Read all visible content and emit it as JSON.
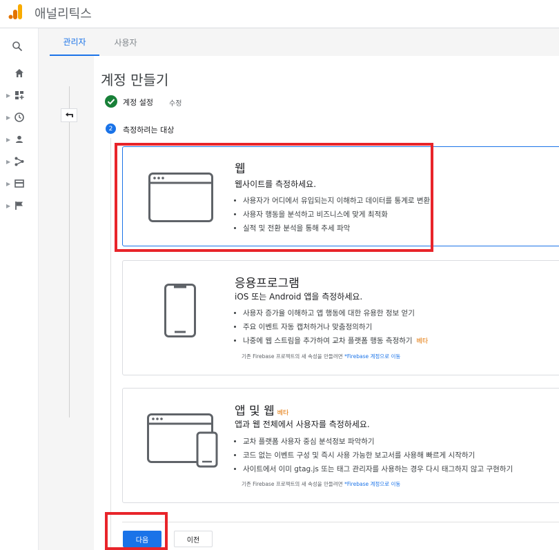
{
  "app": {
    "title": "애널리틱스",
    "logo_icon": "analytics-logo-icon"
  },
  "nav": {
    "items": [
      {
        "icon": "search-icon"
      },
      {
        "icon": "home-icon"
      },
      {
        "icon": "customization-icon"
      },
      {
        "icon": "realtime-clock-icon"
      },
      {
        "icon": "audience-person-icon"
      },
      {
        "icon": "acquisition-icon"
      },
      {
        "icon": "behavior-icon"
      },
      {
        "icon": "conversions-flag-icon"
      }
    ]
  },
  "tabs": {
    "admin": "관리자",
    "user": "사용자"
  },
  "page": {
    "title": "계정 만들기",
    "step1": {
      "label": "계정 설정",
      "edit": "수정"
    },
    "step2": {
      "number": "2",
      "label": "측정하려는 대상"
    }
  },
  "cards": {
    "web": {
      "title": "웹",
      "subtitle": "웹사이트를 측정하세요.",
      "bullets": [
        "사용자가 어디에서 유입되는지 이해하고 데이터를 통계로 변환",
        "사용자 행동을 분석하고 비즈니스에 맞게 최적화",
        "실적 및 전환 분석을 통해 추세 파악"
      ]
    },
    "app": {
      "title": "응용프로그램",
      "subtitle": "iOS 또는 Android 앱을 측정하세요.",
      "bullets": [
        "사용자 증가율 이해하고 앱 행동에 대한 유용한 정보 얻기",
        "주요 이벤트 자동 캡처하거나 맞춤정의하기",
        "나중에 웹 스트림을 추가하여 교차 플랫폼 행동 측정하기"
      ],
      "beta": "베타",
      "note_prefix": "기존 Firebase 프로젝트의 새 속성을 만들려면 ",
      "note_link": "*Firebase 계정으로 이동"
    },
    "appweb": {
      "title": "앱 및 웹",
      "beta": "베타",
      "subtitle": "앱과 웹 전체에서 사용자를 측정하세요.",
      "bullets": [
        "교차 플랫폼 사용자 중심 분석정보 파악하기",
        "코드 없는 이벤트 구성 및 즉시 사용 가능한 보고서를 사용해 빠르게 시작하기",
        "사이트에서 이미 gtag.js 또는 태그 관리자를 사용하는 경우 다시 태그하지 않고 구현하기"
      ],
      "note_prefix": "기존 Firebase 프로젝트의 새 속성을 만들려면 ",
      "note_link": "*Firebase 계정으로 이동"
    }
  },
  "buttons": {
    "next": "다음",
    "prev": "이전"
  },
  "colors": {
    "accent": "#1a73e8",
    "success": "#188038",
    "beta": "#e37400",
    "highlight": "#e8242a"
  }
}
